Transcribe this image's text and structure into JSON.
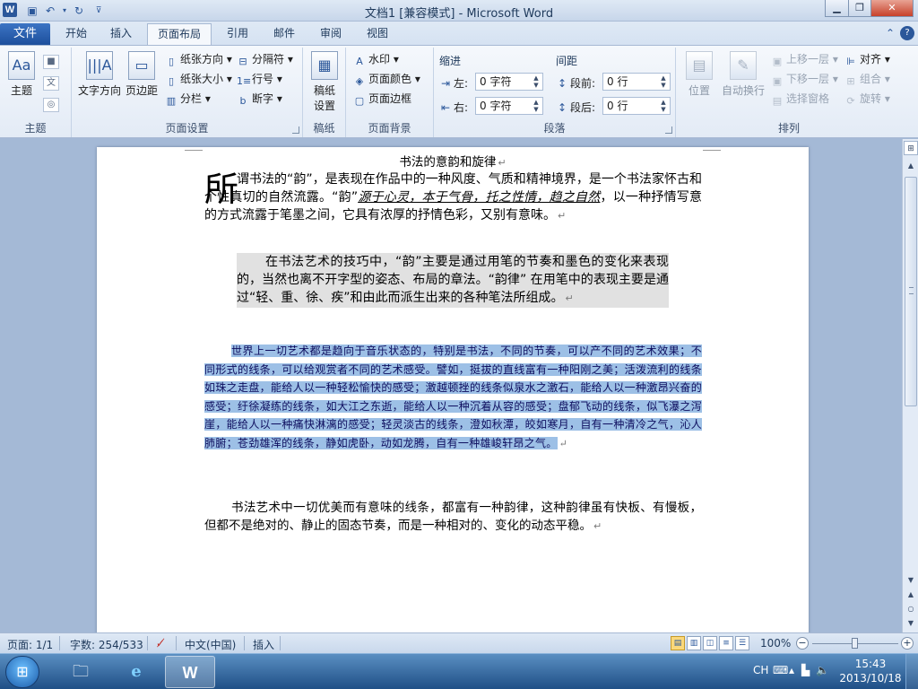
{
  "titlebar": {
    "title": "文档1 [兼容模式] - Microsoft Word",
    "app_icon": "W",
    "quick_access": [
      "save-icon",
      "undo-icon",
      "redo-icon",
      "customize-icon"
    ],
    "window_buttons": [
      "minimize",
      "maximize",
      "close"
    ]
  },
  "tabs": {
    "file": "文件",
    "items": [
      "开始",
      "插入",
      "页面布局",
      "引用",
      "邮件",
      "审阅",
      "视图"
    ],
    "active": "页面布局"
  },
  "ribbon": {
    "theme": {
      "label": "主题",
      "button": "主题",
      "mini_icons": [
        "colors-icon",
        "fonts-icon",
        "effects-icon"
      ]
    },
    "page_setup": {
      "label": "页面设置",
      "big_buttons": [
        "文字方向",
        "页边距"
      ],
      "small": [
        "纸张方向",
        "纸张大小",
        "分栏",
        "分隔符",
        "行号",
        "断字"
      ]
    },
    "manuscript": {
      "label": "稿纸",
      "button_line1": "稿纸",
      "button_line2": "设置"
    },
    "page_background": {
      "label": "页面背景",
      "small": [
        "水印",
        "页面颜色",
        "页面边框"
      ]
    },
    "paragraph": {
      "label": "段落",
      "indent_title": "缩进",
      "spacing_title": "间距",
      "left_label": "左:",
      "left_value": "0 字符",
      "right_label": "右:",
      "right_value": "0 字符",
      "before_label": "段前:",
      "before_value": "0 行",
      "after_label": "段后:",
      "after_value": "0 行"
    },
    "arrange": {
      "label": "排列",
      "big_buttons": [
        "位置",
        "自动换行"
      ],
      "small": [
        "上移一层",
        "下移一层",
        "选择窗格",
        "对齐",
        "组合",
        "旋转"
      ]
    }
  },
  "document": {
    "title": "书法的意韵和旋律",
    "dropcap": "所",
    "para1_a": "谓书法的“韵”，是表现在作品中的一种风度、气质和精神境界，是一个书法家怀古和个性真切的自然流露。“韵”",
    "para1_b": "源于心灵，本于气骨，托之性情，趋之自然",
    "para1_c": "，以一种抒情写意的方式流露于笔墨之间，它具有浓厚的抒情色彩，又别有意味。",
    "para2": "在书法艺术的技巧中，“韵”主要是通过用笔的节奏和墨色的变化来表现的，当然也离不开字型的姿态、布局的章法。“韵律” 在用笔中的表现主要是通过“轻、重、徐、疾”和由此而派生出来的各种笔法所组成。",
    "para3": "世界上一切艺术都是趋向于音乐状态的，特别是书法，不同的节奏，可以产不同的艺术效果；不同形式的线条，可以给观赏者不同的艺术感受。譬如，挺拔的直线富有一种阳刚之美；活泼流利的线条如珠之走盘，能给人以一种轻松愉快的感受；激越顿挫的线条似泉水之激石，能给人以一种激昂兴奋的感受；纡徐凝练的线条，如大江之东逝，能给人以一种沉着从容的感受；盘郁飞动的线条，似飞瀑之泻崖，能给人以一种痛快淋漓的感受；轻灵淡古的线条，澄如秋潭，皎如寒月，自有一种清冷之气，沁人肺腑；苍劲雄浑的线条，静如虎卧，动如龙腾，自有一种雄峻轩昂之气。",
    "para4": "书法艺术中一切优美而有意味的线条，都富有一种韵律，这种韵律虽有快板、有慢板，但都不是绝对的、静止的固态节奏，而是一种相对的、变化的动态平稳。",
    "para_mark": "↵"
  },
  "statusbar": {
    "page": "页面: 1/1",
    "words": "字数: 254/533",
    "language": "中文(中国)",
    "mode": "插入",
    "zoom": "100%",
    "zoom_value_percent": 100,
    "views": [
      "print-layout-icon",
      "full-screen-reading-icon",
      "web-layout-icon",
      "outline-icon",
      "draft-icon"
    ]
  },
  "taskbar": {
    "start": "start-orb-icon",
    "apps": [
      "file-explorer-icon",
      "internet-explorer-icon",
      "word-icon"
    ],
    "input_lang": "CH",
    "time": "15:43",
    "date": "2013/10/18"
  }
}
